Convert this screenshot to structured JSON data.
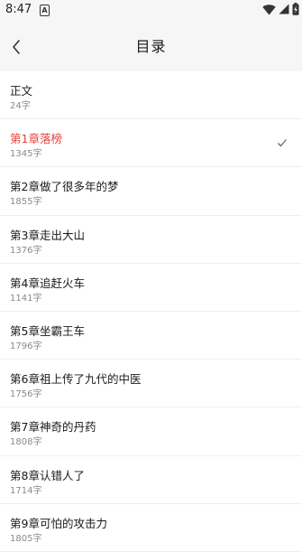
{
  "status_bar": {
    "time": "8:47",
    "notification_letter": "A",
    "icons": [
      "wifi-icon",
      "signal-icon",
      "battery-icon"
    ]
  },
  "app_bar": {
    "title": "目录",
    "back_icon": "back-arrow-icon"
  },
  "colors": {
    "accent": "#e2453c",
    "bar_background": "#f6f6f6",
    "divider": "#efefef"
  },
  "chapters": [
    {
      "name": "正文",
      "count": "24字",
      "current": false
    },
    {
      "name": "第1章落榜",
      "count": "1345字",
      "current": true
    },
    {
      "name": "第2章做了很多年的梦",
      "count": "1855字",
      "current": false
    },
    {
      "name": "第3章走出大山",
      "count": "1376字",
      "current": false
    },
    {
      "name": "第4章追赶火车",
      "count": "1141字",
      "current": false
    },
    {
      "name": "第5章坐霸王车",
      "count": "1796字",
      "current": false
    },
    {
      "name": "第6章祖上传了九代的中医",
      "count": "1756字",
      "current": false
    },
    {
      "name": "第7章神奇的丹药",
      "count": "1808字",
      "current": false
    },
    {
      "name": "第8章认错人了",
      "count": "1714字",
      "current": false
    },
    {
      "name": "第9章可怕的攻击力",
      "count": "1805字",
      "current": false
    }
  ]
}
